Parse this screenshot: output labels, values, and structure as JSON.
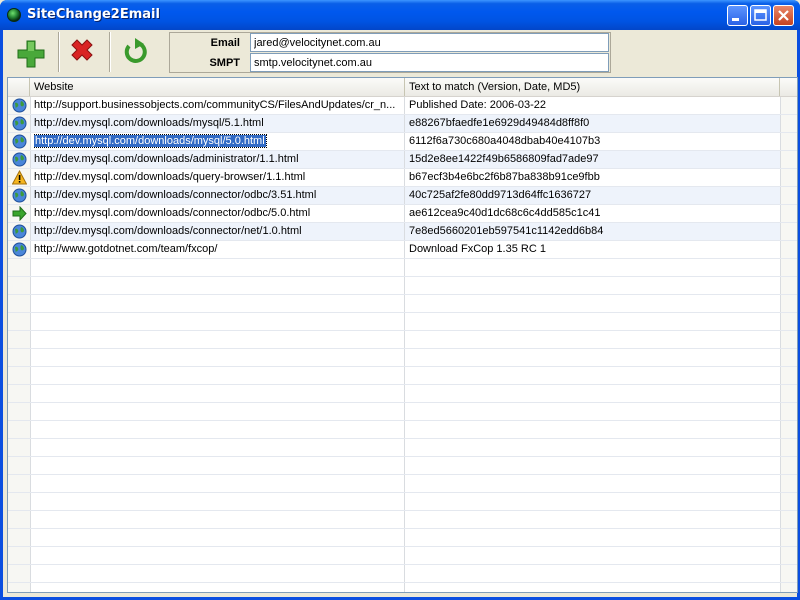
{
  "window": {
    "title": "SiteChange2Email"
  },
  "toolbar": {
    "add_icon": "add-plus-icon",
    "delete_icon": "delete-x-icon",
    "refresh_icon": "refresh-icon"
  },
  "credentials": {
    "email_label": "Email",
    "email_value": "jared@velocitynet.com.au",
    "smpt_label": "SMPT",
    "smpt_value": "smtp.velocitynet.com.au"
  },
  "grid": {
    "columns": {
      "website": "Website",
      "text": "Text to match (Version, Date, MD5)"
    },
    "rows": [
      {
        "icon": "globe-icon",
        "website": "http://support.businessobjects.com/communityCS/FilesAndUpdates/cr_n...",
        "text": "Published Date: 2006-03-22"
      },
      {
        "icon": "globe-icon",
        "website": "http://dev.mysql.com/downloads/mysql/5.1.html",
        "text": "e88267bfaedfe1e6929d49484d8ff8f0"
      },
      {
        "icon": "globe-icon",
        "website": "http://dev.mysql.com/downloads/mysql/5.0.html",
        "text": "6112f6a730c680a4048dbab40e4107b3",
        "selected": true
      },
      {
        "icon": "globe-icon",
        "website": "http://dev.mysql.com/downloads/administrator/1.1.html",
        "text": "15d2e8ee1422f49b6586809fad7ade97"
      },
      {
        "icon": "warning-icon",
        "website": "http://dev.mysql.com/downloads/query-browser/1.1.html",
        "text": "b67ecf3b4e6bc2f6b87ba838b91ce9fbb"
      },
      {
        "icon": "globe-icon",
        "website": "http://dev.mysql.com/downloads/connector/odbc/3.51.html",
        "text": "40c725af2fe80dd9713d64ffc1636727"
      },
      {
        "icon": "arrow-right-icon",
        "website": "http://dev.mysql.com/downloads/connector/odbc/5.0.html",
        "text": "ae612cea9c40d1dc68c6c4dd585c1c41"
      },
      {
        "icon": "globe-icon",
        "website": "http://dev.mysql.com/downloads/connector/net/1.0.html",
        "text": "7e8ed5660201eb597541c1142edd6b84"
      },
      {
        "icon": "globe-icon",
        "website": "http://www.gotdotnet.com/team/fxcop/",
        "text": "Download FxCop 1.35 RC 1"
      }
    ]
  }
}
